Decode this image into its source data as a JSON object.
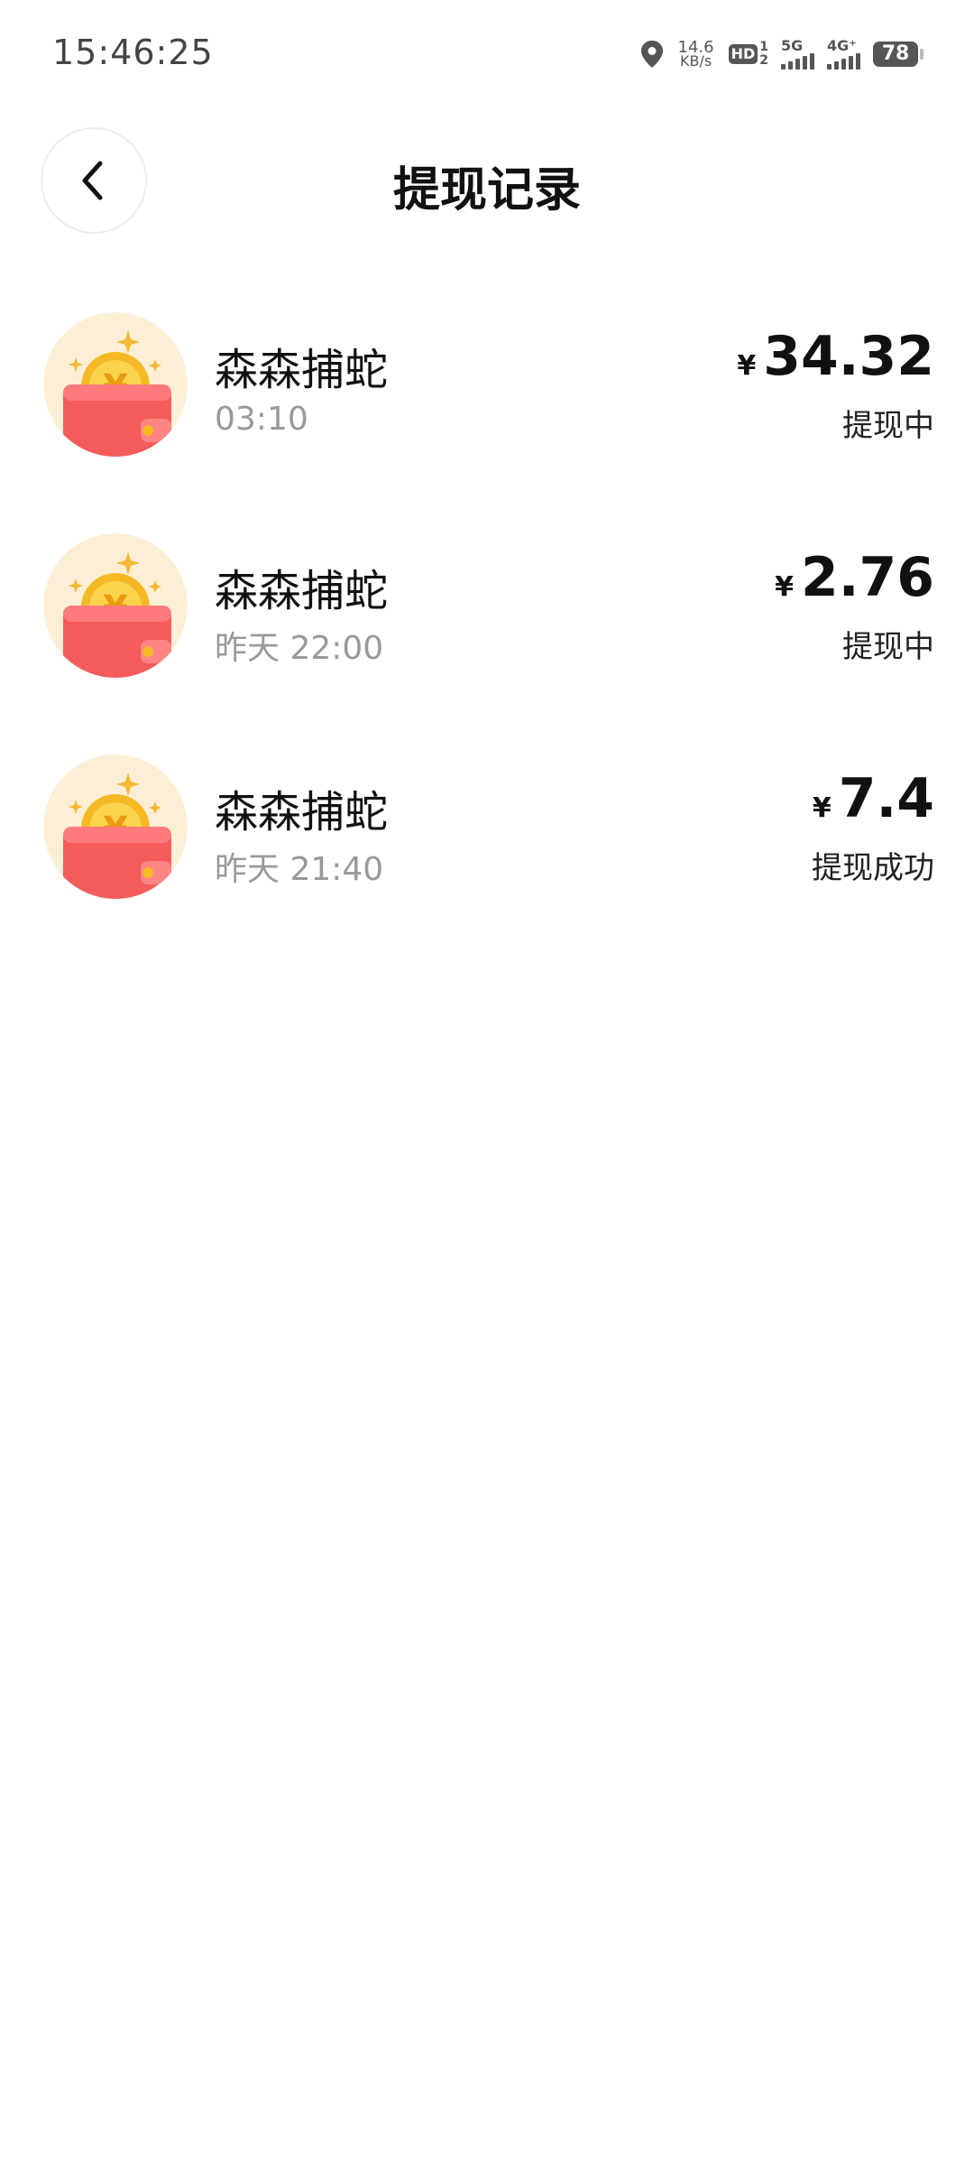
{
  "status_bar": {
    "time": "15:46:25",
    "net_speed_value": "14.6",
    "net_speed_unit": "KB/s",
    "hd_label": "HD",
    "hd_sub_top": "1",
    "hd_sub_bottom": "2",
    "sim1_tag": "5G",
    "sim2_tag": "4G⁺",
    "battery_level": "78",
    "icons": [
      "location-icon",
      "hd-voice-icon",
      "signal-5g-icon",
      "signal-4g-icon",
      "battery-icon"
    ]
  },
  "header": {
    "title": "提现记录",
    "back_icon": "chevron-left-icon"
  },
  "records": [
    {
      "name": "森森捕蛇",
      "time": "03:10",
      "currency": "¥",
      "amount": "34.32",
      "status": "提现中",
      "icon": "wallet-coin-icon"
    },
    {
      "name": "森森捕蛇",
      "time": "昨天 22:00",
      "currency": "¥",
      "amount": "2.76",
      "status": "提现中",
      "icon": "wallet-coin-icon"
    },
    {
      "name": "森森捕蛇",
      "time": "昨天 21:40",
      "currency": "¥",
      "amount": "7.4",
      "status": "提现成功",
      "icon": "wallet-coin-icon"
    }
  ],
  "colors": {
    "icon_bg": "#fdefd6",
    "wallet_red": "#f45b5b",
    "coin_gold": "#f5b926",
    "sparkle": "#f7b733",
    "time_gray": "#999999"
  }
}
